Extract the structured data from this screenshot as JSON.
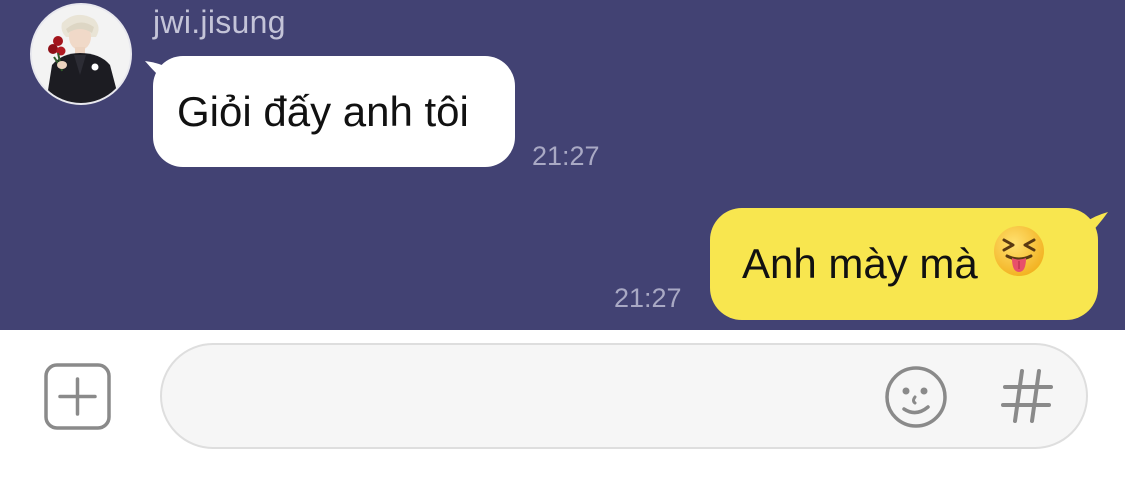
{
  "theme": {
    "chat_background": "#424273",
    "incoming_bubble": "#ffffff",
    "outgoing_bubble": "#f8e64f",
    "input_bar_background": "#ffffff",
    "icon_color": "#8a8a8a"
  },
  "conversation": {
    "messages": [
      {
        "direction": "incoming",
        "sender": "jwi.jisung",
        "text": "Giỏi đấy anh tôi",
        "time": "21:27"
      },
      {
        "direction": "outgoing",
        "text": "Anh mày mà",
        "emoji": "squinting-face-with-tongue",
        "time": "21:27"
      }
    ]
  },
  "input_bar": {
    "add_icon": "plus-square-icon",
    "message_value": "",
    "emoticon_icon": "smiley-icon",
    "hashtag_label": "#"
  }
}
